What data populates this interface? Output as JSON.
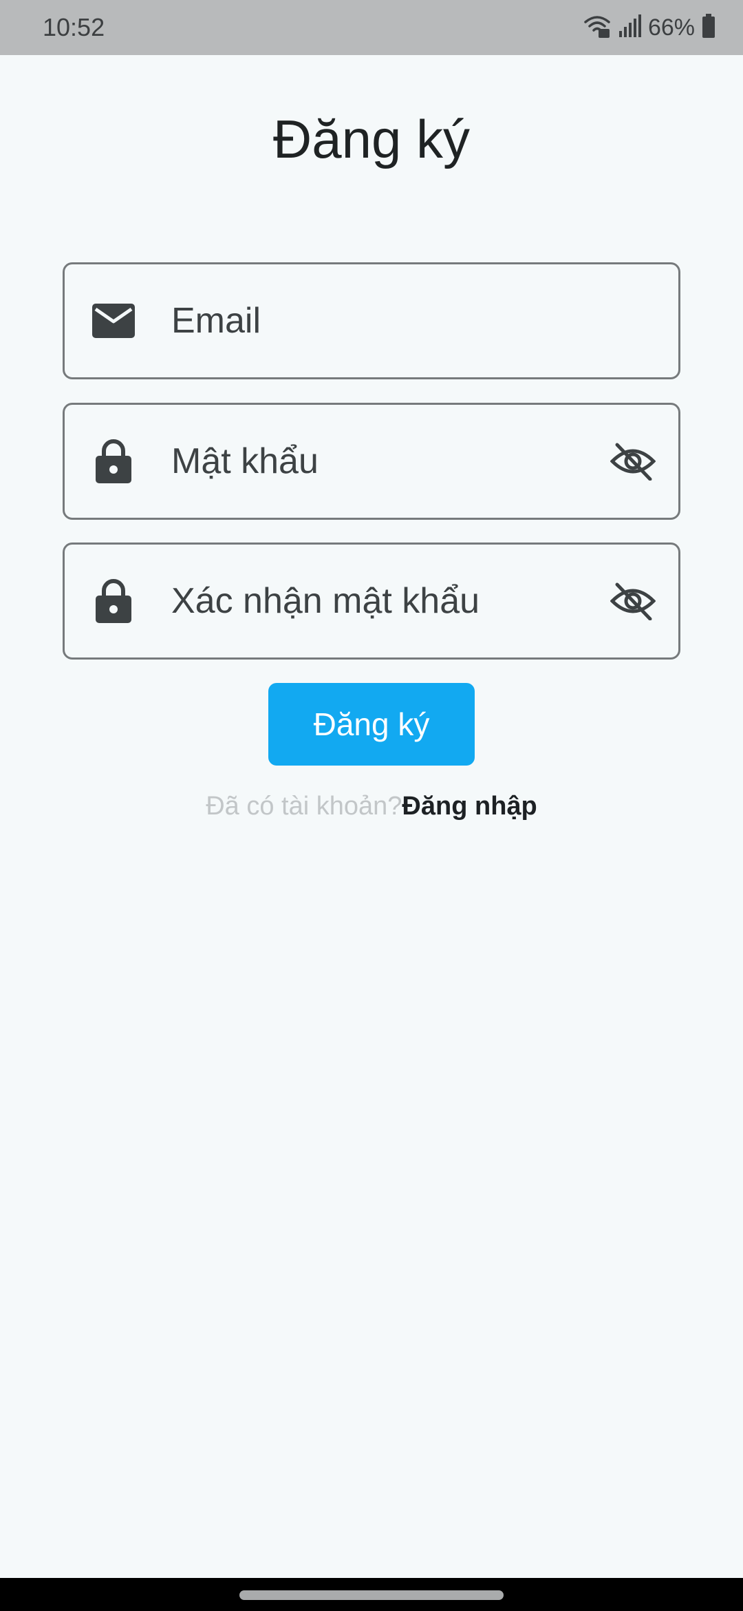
{
  "status_bar": {
    "time": "10:52",
    "battery_percent": "66%",
    "wifi_icon": "wifi-calling-icon",
    "signal_icon": "cell-signal-icon",
    "battery_icon": "battery-icon"
  },
  "page": {
    "title": "Đăng ký"
  },
  "form": {
    "email": {
      "placeholder": "Email",
      "icon": "mail-icon"
    },
    "password": {
      "placeholder": "Mật khẩu",
      "icon": "lock-icon",
      "toggle_icon": "eye-off-icon"
    },
    "confirm_password": {
      "placeholder": "Xác nhận mật khẩu",
      "icon": "lock-icon",
      "toggle_icon": "eye-off-icon"
    },
    "submit_label": "Đăng ký"
  },
  "footer": {
    "question": "Đã có tài khoản?",
    "login_link": "Đăng nhập"
  },
  "colors": {
    "background": "#f5f9fa",
    "accent": "#12a9f1",
    "status_bar": "#b8babb",
    "field_border": "#767a7c"
  }
}
